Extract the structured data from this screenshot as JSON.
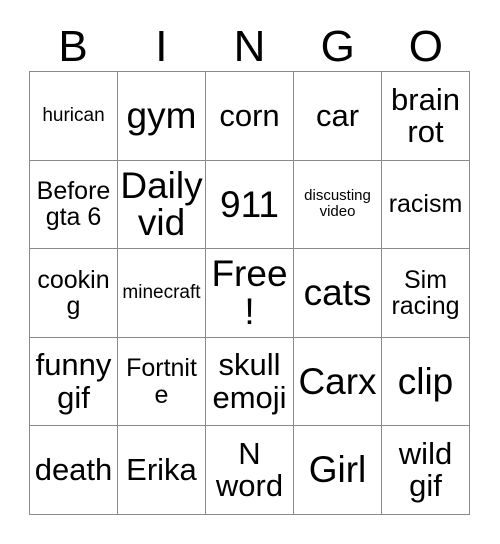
{
  "card": {
    "type": "bingo-card",
    "columns": 5,
    "rows": 5,
    "border_color": "#8a8a8a",
    "background_color": "#ffffff",
    "text_color": "#000000",
    "headers": [
      "B",
      "I",
      "N",
      "G",
      "O"
    ],
    "cells": [
      [
        {
          "text": "hurican",
          "size": "s"
        },
        {
          "text": "gym",
          "size": "xl"
        },
        {
          "text": "corn",
          "size": "l"
        },
        {
          "text": "car",
          "size": "l"
        },
        {
          "text": "brain rot",
          "size": "l"
        }
      ],
      [
        {
          "text": "Before gta 6",
          "size": "m"
        },
        {
          "text": "Daily vid",
          "size": "xl"
        },
        {
          "text": "911",
          "size": "xl"
        },
        {
          "text": "discusting video",
          "size": "xs"
        },
        {
          "text": "racism",
          "size": "m"
        }
      ],
      [
        {
          "text": "cooking",
          "size": "m"
        },
        {
          "text": "minecraft",
          "size": "s"
        },
        {
          "text": "Free!",
          "size": "xl"
        },
        {
          "text": "cats",
          "size": "xl"
        },
        {
          "text": "Sim racing",
          "size": "m"
        }
      ],
      [
        {
          "text": "funny gif",
          "size": "l"
        },
        {
          "text": "Fortnite",
          "size": "m"
        },
        {
          "text": "skull emoji",
          "size": "l"
        },
        {
          "text": "Carx",
          "size": "xl"
        },
        {
          "text": "clip",
          "size": "xl"
        }
      ],
      [
        {
          "text": "death",
          "size": "l"
        },
        {
          "text": "Erika",
          "size": "l"
        },
        {
          "text": "N word",
          "size": "l"
        },
        {
          "text": "Girl",
          "size": "xl"
        },
        {
          "text": "wild gif",
          "size": "l"
        }
      ]
    ]
  }
}
